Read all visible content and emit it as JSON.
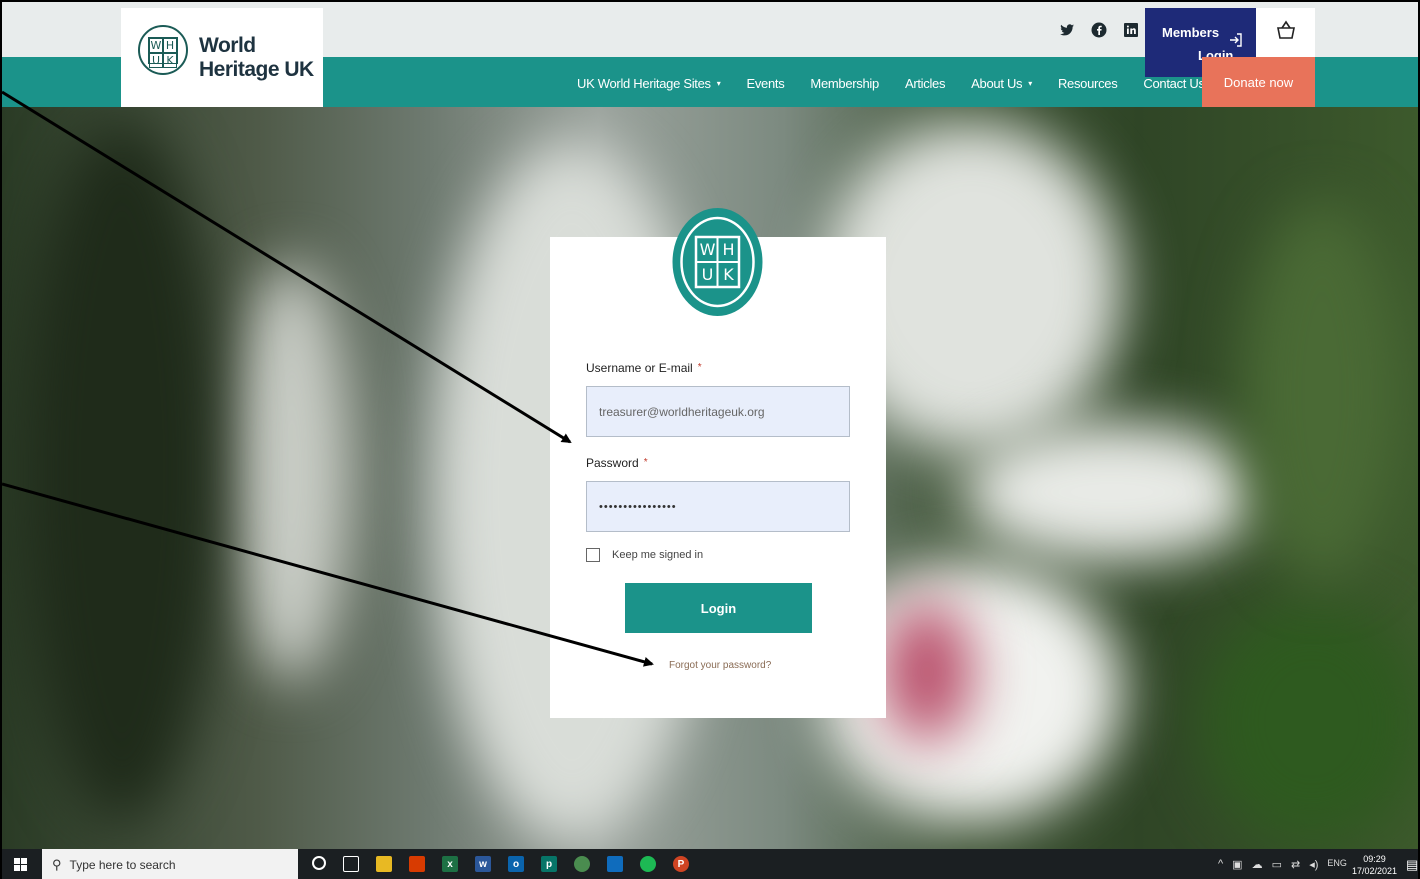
{
  "header": {
    "brand_line1": "World",
    "brand_line2": "Heritage UK",
    "logo_letters": [
      "W",
      "H",
      "U",
      "K"
    ],
    "social_icons": [
      "twitter-icon",
      "facebook-icon",
      "linkedin-icon"
    ],
    "members_login_line1": "Members",
    "members_login_line2": "Login",
    "members_login_icon": "login-arrow-icon",
    "basket_icon": "basket-icon"
  },
  "nav": {
    "items": [
      {
        "label": "UK World Heritage Sites",
        "has_dropdown": true
      },
      {
        "label": "Events",
        "has_dropdown": false
      },
      {
        "label": "Membership",
        "has_dropdown": false
      },
      {
        "label": "Articles",
        "has_dropdown": false
      },
      {
        "label": "About Us",
        "has_dropdown": true
      },
      {
        "label": "Resources",
        "has_dropdown": false
      },
      {
        "label": "Contact Us",
        "has_dropdown": false
      }
    ],
    "donate": "Donate now"
  },
  "login_form": {
    "username_label": "Username or E-mail",
    "username_value": "treasurer@worldheritageuk.org",
    "password_label": "Password",
    "password_value": "••••••••••••••••",
    "required_marker": "*",
    "keep_signed_in": "Keep me signed in",
    "login_button": "Login",
    "forgot_password": "Forgot your password?"
  },
  "taskbar": {
    "search_placeholder": "Type here to search",
    "language": "ENG",
    "time": "09:29",
    "date": "17/02/2021"
  },
  "colors": {
    "teal": "#1b938a",
    "navy": "#1e2a78",
    "donate": "#e8735a",
    "input_bg": "#e8eefb"
  }
}
